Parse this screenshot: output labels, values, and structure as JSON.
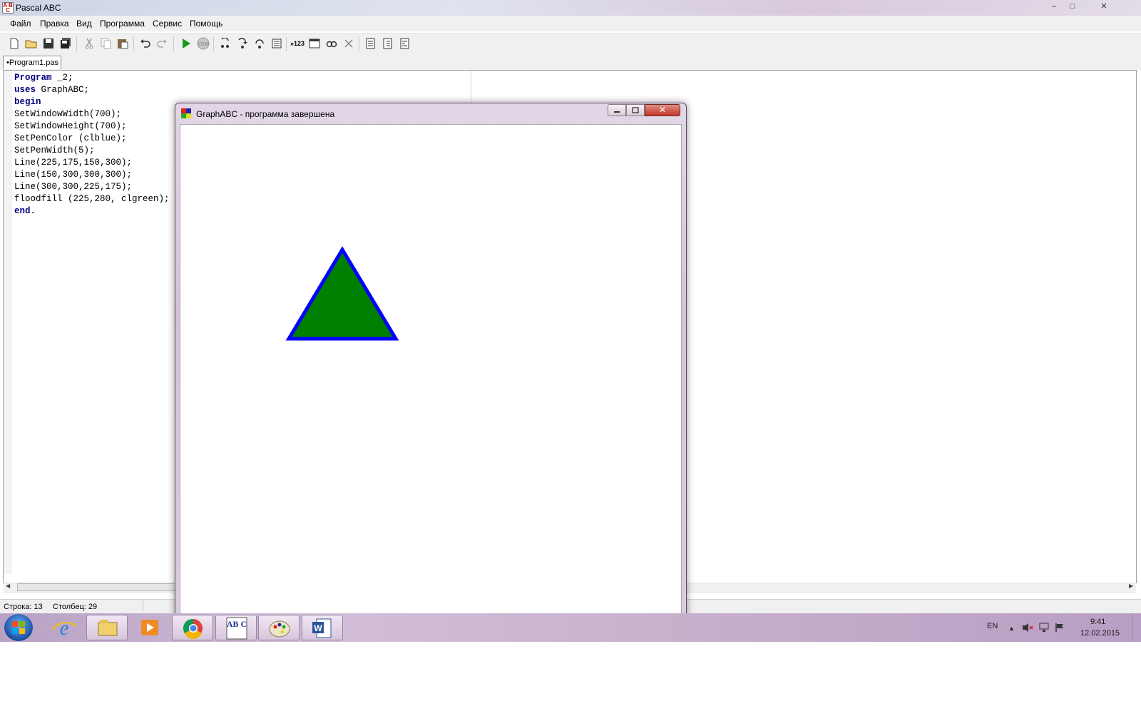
{
  "window": {
    "title": "Pascal ABC",
    "minimize": "–",
    "maximize": "□",
    "close": "✕"
  },
  "menu": [
    "Файл",
    "Правка",
    "Вид",
    "Программа",
    "Сервис",
    "Помощь"
  ],
  "toolbar": {
    "icons": [
      "new-file-icon",
      "open-folder-icon",
      "save-icon",
      "save-all-icon",
      "cut-icon",
      "copy-icon",
      "paste-icon",
      "undo-icon",
      "redo-icon",
      "run-icon",
      "stop-icon",
      "step-into-icon",
      "step-over-icon",
      "step-out-icon",
      "breakpoint-icon",
      "output-123-icon",
      "window-icon",
      "watch-icon",
      "clear-icon",
      "format-code-icon",
      "indent-icon",
      "compile-icon"
    ],
    "stop_label": "STOP",
    "output_label": "»123"
  },
  "tab": {
    "label": "•Program1.pas"
  },
  "code": [
    "Program _2;",
    "uses GraphABC;",
    "begin",
    "SetWindowWidth(700);",
    "SetWindowHeight(700);",
    "SetPenColor (clblue);",
    "SetPenWidth(5);",
    "Line(225,175,150,300);",
    "Line(150,300,300,300);",
    "Line(300,300,225,175);",
    "floodfill (225,280, clgreen);",
    "end."
  ],
  "status": {
    "row": "Строка: 13",
    "col": "Столбец: 29"
  },
  "graph_window": {
    "title": "GraphABC - программа завершена",
    "close": "✕",
    "shape": {
      "type": "triangle",
      "stroke": "#0000ff",
      "fill": "#008000"
    }
  },
  "taskbar": {
    "apps": [
      "start-orb",
      "internet-explorer-icon",
      "file-explorer-icon",
      "media-player-icon",
      "chrome-icon",
      "pascal-abc-icon",
      "paint-icon",
      "word-icon"
    ],
    "abc_label": "AB C",
    "word_label": "W",
    "lang": "EN",
    "time": "9:41",
    "date": "12.02.2015"
  },
  "colors": {
    "code_keyword": "#000080",
    "triangle_stroke": "#0000ff",
    "triangle_fill": "#008000"
  }
}
